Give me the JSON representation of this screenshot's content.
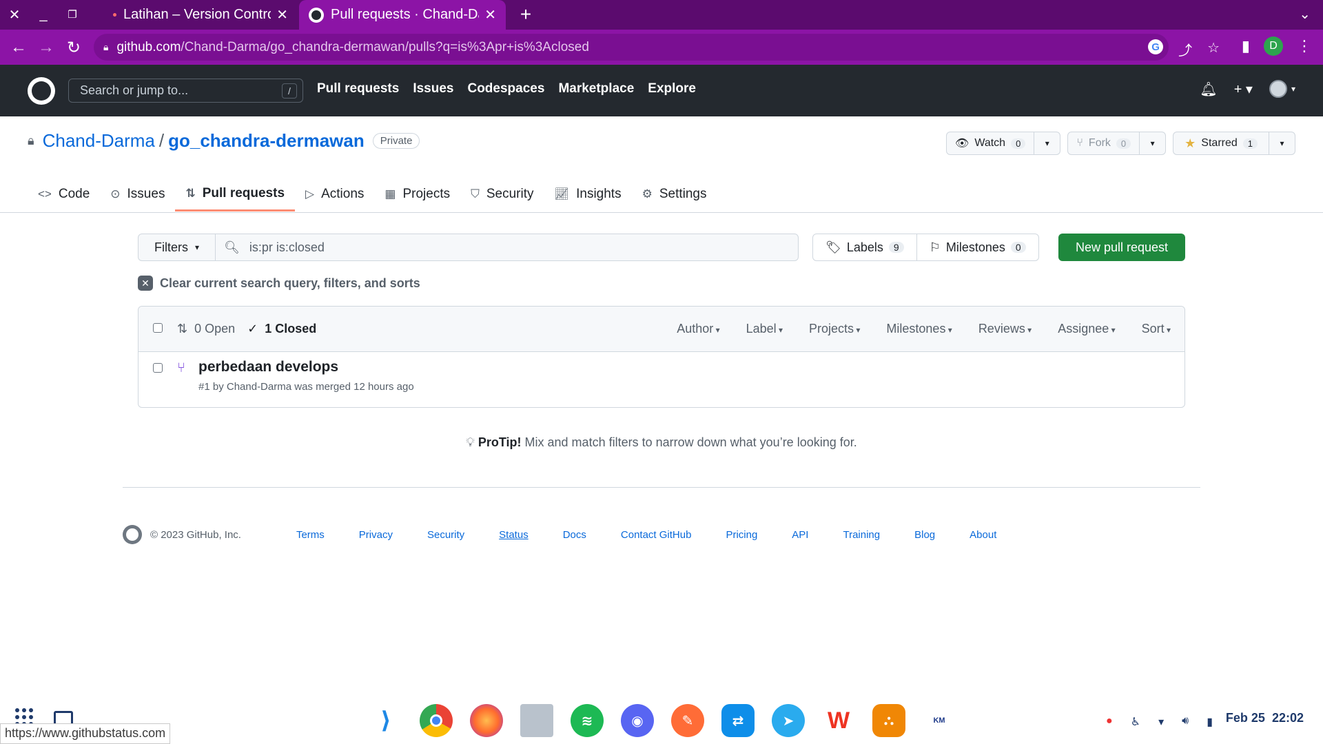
{
  "browser": {
    "tabs": [
      {
        "title": "Latihan – Version Control"
      },
      {
        "title": "Pull requests · Chand-Darma"
      }
    ],
    "url_host": "github.com",
    "url_path": "/Chand-Darma/go_chandra-dermawan/pulls?q=is%3Apr+is%3Aclosed",
    "profile_initial": "D",
    "status_url": "https://www.githubstatus.com"
  },
  "gh_header": {
    "search_placeholder": "Search or jump to...",
    "search_shortcut": "/",
    "nav": [
      "Pull requests",
      "Issues",
      "Codespaces",
      "Marketplace",
      "Explore"
    ]
  },
  "repo": {
    "owner": "Chand-Darma",
    "separator": "/",
    "name": "go_chandra-dermawan",
    "visibility": "Private",
    "watch_label": "Watch",
    "watch_count": "0",
    "fork_label": "Fork",
    "fork_count": "0",
    "star_label": "Starred",
    "star_count": "1",
    "tabs": [
      "Code",
      "Issues",
      "Pull requests",
      "Actions",
      "Projects",
      "Security",
      "Insights",
      "Settings"
    ]
  },
  "prs": {
    "filters_label": "Filters",
    "query": "is:pr is:closed",
    "labels_label": "Labels",
    "labels_count": "9",
    "milestones_label": "Milestones",
    "milestones_count": "0",
    "new_pr_label": "New pull request",
    "clear_label": "Clear current search query, filters, and sorts",
    "open_label": "0 Open",
    "closed_label": "1 Closed",
    "header_filters": [
      "Author",
      "Label",
      "Projects",
      "Milestones",
      "Reviews",
      "Assignee",
      "Sort"
    ],
    "items": [
      {
        "title": "perbedaan develops",
        "meta": "#1 by Chand-Darma was merged 12 hours ago"
      }
    ],
    "protip_bold": "ProTip!",
    "protip_text": " Mix and match filters to narrow down what you’re looking for."
  },
  "footer": {
    "copyright": "© 2023 GitHub, Inc.",
    "links": [
      "Terms",
      "Privacy",
      "Security",
      "Status",
      "Docs",
      "Contact GitHub",
      "Pricing",
      "API",
      "Training",
      "Blog",
      "About"
    ]
  },
  "taskbar": {
    "date": "Feb 25",
    "time": "22:02",
    "apps": [
      "vscode",
      "chrome",
      "firefox",
      "files",
      "spotify",
      "discord",
      "postman",
      "teamviewer",
      "telegram",
      "wps",
      "draw",
      "kampus-merdeka"
    ]
  },
  "colors": {
    "tabbar": "#5b0b6e",
    "addrbar": "#8c14a6",
    "gh_header": "#24292f",
    "primary_button": "#1f883d",
    "link": "#0969da",
    "merged": "#8250df",
    "active_tab_underline": "#fd8c73"
  }
}
